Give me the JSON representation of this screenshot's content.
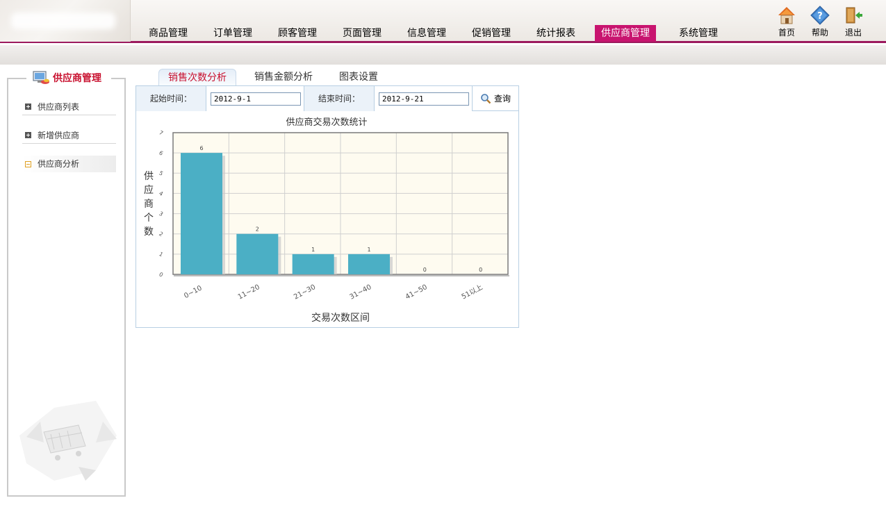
{
  "nav": {
    "items": [
      "商品管理",
      "订单管理",
      "顾客管理",
      "页面管理",
      "信息管理",
      "促销管理",
      "统计报表",
      "供应商管理",
      "系统管理"
    ],
    "active": "供应商管理"
  },
  "tools": {
    "home": "首页",
    "help": "帮助",
    "exit": "退出"
  },
  "sidebar": {
    "title": "供应商管理",
    "items": [
      {
        "label": "供应商列表"
      },
      {
        "label": "新增供应商"
      },
      {
        "label": "供应商分析"
      }
    ],
    "active": "供应商分析"
  },
  "tabs": [
    "销售次数分析",
    "销售金额分析",
    "图表设置"
  ],
  "active_tab": "销售次数分析",
  "filter": {
    "start_label": "起始时间：",
    "start_value": "2012-9-1",
    "end_label": "结束时间：",
    "end_value": "2012-9-21",
    "query_label": "查询"
  },
  "colors": {
    "accent": "#c8146f",
    "bar": "#4bafc5",
    "plot_bg": "#fefbf0",
    "title_red": "#c8102e"
  },
  "chart_data": {
    "type": "bar",
    "title": "供应商交易次数统计",
    "xlabel": "交易次数区间",
    "ylabel": "供应商个数",
    "categories": [
      "0~10",
      "11~20",
      "21~30",
      "31~40",
      "41~50",
      "51以上"
    ],
    "values": [
      6,
      2,
      1,
      1,
      0,
      0
    ],
    "ylim": [
      0,
      7
    ],
    "yticks": [
      "0",
      "1",
      "2",
      "3",
      "4",
      "5",
      "6",
      "7"
    ],
    "grid": true,
    "data_labels": [
      "6",
      "2",
      "1",
      "1",
      "0",
      "0"
    ]
  }
}
